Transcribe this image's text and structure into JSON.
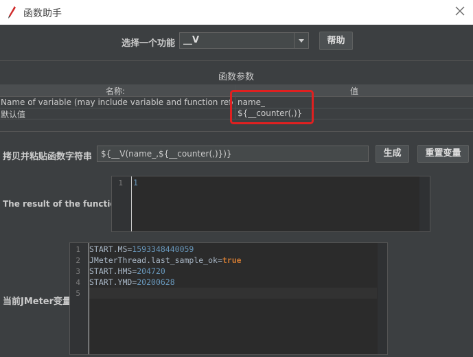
{
  "window": {
    "title": "函数助手"
  },
  "selector": {
    "label": "选择一个功能",
    "selected": "__V",
    "help_label": "帮助"
  },
  "params": {
    "section_title": "函数参数",
    "headers": {
      "name": "名称:",
      "value": "值"
    },
    "rows": [
      {
        "name": "Name of variable (may include variable and function referenc...",
        "value": "name_"
      },
      {
        "name": "默认值",
        "value": "${__counter(,)}"
      }
    ]
  },
  "copy": {
    "label": "拷贝并粘贴函数字符串",
    "value": "${__V(name_,${__counter(,)})}",
    "generate_label": "生成",
    "reset_label": "重置变量"
  },
  "result": {
    "label": "The result of the function is",
    "lines": [
      {
        "num": "1",
        "text": "1"
      }
    ]
  },
  "vars": {
    "label": "当前JMeter变量",
    "lines": [
      {
        "num": "1",
        "key": "START.MS",
        "eq": "=",
        "val": "1593348440059",
        "kind": "num"
      },
      {
        "num": "2",
        "key": "JMeterThread.last_sample_ok",
        "eq": "=",
        "val": "true",
        "kind": "bool"
      },
      {
        "num": "3",
        "key": "START.HMS",
        "eq": "=",
        "val": "204720",
        "kind": "num"
      },
      {
        "num": "4",
        "key": "START.YMD",
        "eq": "=",
        "val": "20200628",
        "kind": "num"
      },
      {
        "num": "5",
        "key": "",
        "eq": "",
        "val": "",
        "kind": "none"
      }
    ]
  },
  "colors": {
    "number": "#6897bb",
    "keyword": "#cc7832",
    "key": "#a9b7c6",
    "highlight": "#e02020"
  },
  "icons": {
    "app": "feather-icon",
    "close": "close-icon",
    "dropdown": "chevron-down-icon"
  }
}
